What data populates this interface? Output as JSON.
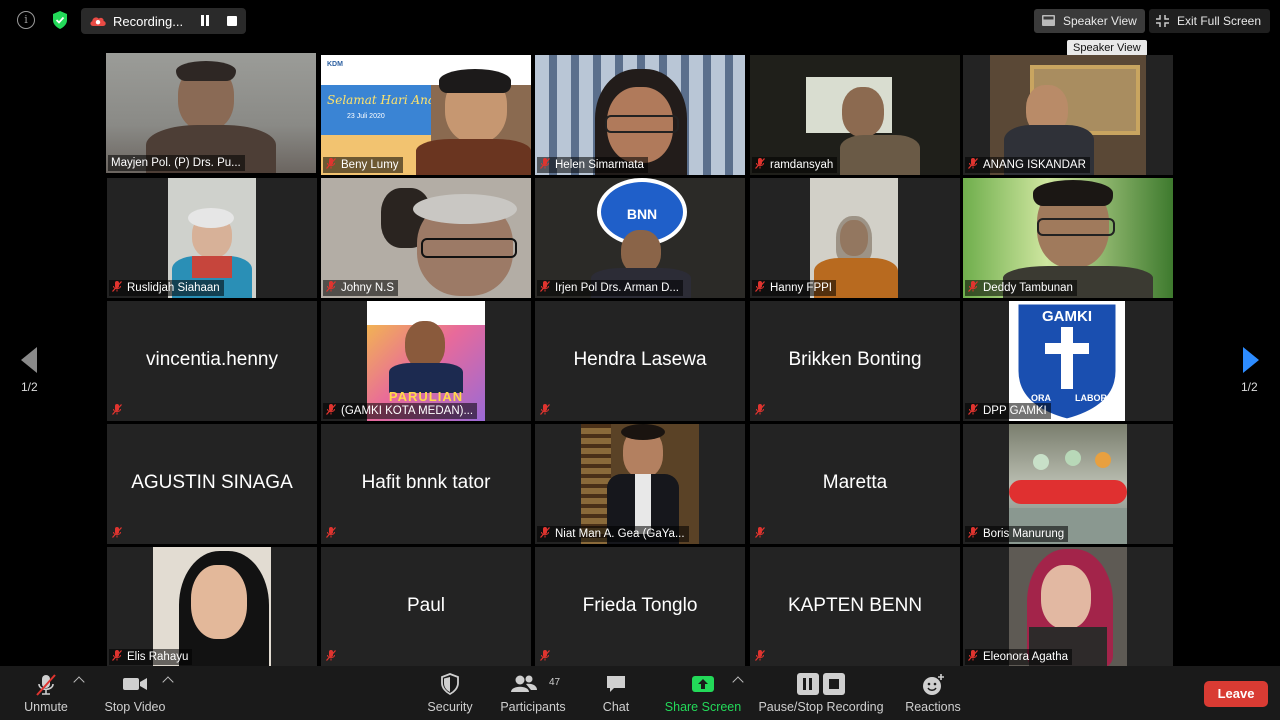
{
  "topbar": {
    "recording_label": "Recording...",
    "speaker_view_label": "Speaker View",
    "exit_fullscreen_label": "Exit Full Screen",
    "tooltip": "Speaker View"
  },
  "pager": {
    "left": "1/2",
    "right": "1/2"
  },
  "participants": [
    {
      "name": "Mayjen Pol. (P) Drs. Pu...",
      "video": true,
      "active": true,
      "muted": false
    },
    {
      "name": "Beny Lumy",
      "video": true,
      "muted": true
    },
    {
      "name": "Helen Simarmata",
      "video": true,
      "muted": true
    },
    {
      "name": "ramdansyah",
      "video": true,
      "muted": true
    },
    {
      "name": "ANANG ISKANDAR",
      "video": true,
      "muted": true
    },
    {
      "name": "Ruslidjah Siahaan",
      "video": true,
      "muted": true
    },
    {
      "name": "Johny N.S",
      "video": true,
      "muted": true
    },
    {
      "name": "Irjen Pol Drs. Arman D...",
      "video": true,
      "muted": true
    },
    {
      "name": "Hanny FPPI",
      "video": true,
      "muted": true
    },
    {
      "name": "Deddy Tambunan",
      "video": true,
      "muted": true
    },
    {
      "name": "vincentia.henny",
      "video": false,
      "muted": true
    },
    {
      "name": "(GAMKI KOTA MEDAN)...",
      "video": true,
      "muted": true
    },
    {
      "name": "Hendra Lasewa",
      "video": false,
      "muted": true
    },
    {
      "name": "Brikken Bonting",
      "video": false,
      "muted": true
    },
    {
      "name": "DPP GAMKI",
      "video": true,
      "muted": true
    },
    {
      "name": "AGUSTIN SINAGA",
      "video": false,
      "muted": true
    },
    {
      "name": "Hafit bnnk tator",
      "video": false,
      "muted": true
    },
    {
      "name": "Niat Man A. Gea (GaYa...",
      "video": true,
      "muted": true
    },
    {
      "name": "Maretta",
      "video": false,
      "muted": true
    },
    {
      "name": "Boris Manurung",
      "video": true,
      "muted": true
    },
    {
      "name": "Elis Rahayu",
      "video": true,
      "muted": true
    },
    {
      "name": "Paul",
      "video": false,
      "muted": true
    },
    {
      "name": "Frieda Tonglo",
      "video": false,
      "muted": true
    },
    {
      "name": "KAPTEN BENN",
      "video": false,
      "muted": true
    },
    {
      "name": "Eleonora Agatha",
      "video": true,
      "muted": true
    }
  ],
  "tile_text": {
    "beny_banner": "Selamat Hari Anak",
    "beny_date": "23 Juli 2020",
    "bnn_logo": "BNN",
    "parulian": "PARULIAN",
    "gamki_logo": "GAMKI",
    "gamki_motto_left": "ORA",
    "gamki_motto_right": "LABORA"
  },
  "toolbar": {
    "unmute": "Unmute",
    "stop_video": "Stop Video",
    "security": "Security",
    "participants": "Participants",
    "participants_count": "47",
    "chat": "Chat",
    "share_screen": "Share Screen",
    "recording": "Pause/Stop Recording",
    "reactions": "Reactions",
    "leave": "Leave"
  },
  "colors": {
    "active_speaker_border": "#d4e26b",
    "share_green": "#23d959",
    "leave_red": "#d93b33",
    "page_arrow_blue": "#2d8cff",
    "mute_red": "#e0342f"
  }
}
